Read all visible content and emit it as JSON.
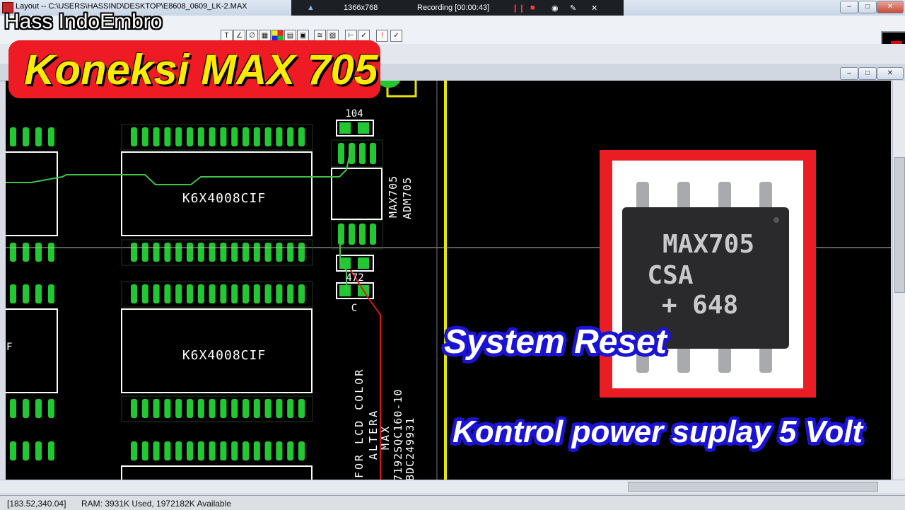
{
  "window": {
    "title": "Layout -- C:\\USERS\\HASSIND\\DESKTOP\\E8608_0609_LK-2.MAX",
    "min": "–",
    "max": "□",
    "close": "✕"
  },
  "recorder": {
    "resolution": "1366x768",
    "status": "Recording [00:00:43]"
  },
  "overlay": {
    "channel": "Hass IndoEmbro",
    "headline": "Koneksi MAX 705",
    "caption1": "System Reset",
    "caption2": "Kontrol power suplay 5 Volt"
  },
  "chip_photo": {
    "line1": "MAX705",
    "line2": "CSA",
    "line3": "+ 648"
  },
  "pcb": {
    "chip_top": "K6X4008CIF",
    "chip_bottom": "K6X4008CIF",
    "cap_top": "104",
    "cap_mid": "472",
    "cap_letter": "C",
    "max_label": "MAX705",
    "adm_label": "ADM705",
    "left_edge_letter": "F",
    "note_col1": "FOR LCD COLOR",
    "note_col2": "ALTERA",
    "note_col3": "MAX",
    "note_col4": "7192SQC160-10",
    "note_col5": "BDC249931"
  },
  "status": {
    "coords": "[183.52,340.04]",
    "ram": "RAM: 3931K Used, 1972182K Available"
  },
  "colors": {
    "pad": "#22c832",
    "silk": "#ffffff",
    "trace_green": "#3ec24a",
    "trace_red": "#d21a1a",
    "board_line": "#e6e600",
    "headline_bg": "#ee1b24",
    "headline_fg": "#ffeb00",
    "caption_outline": "#1a13d6"
  }
}
